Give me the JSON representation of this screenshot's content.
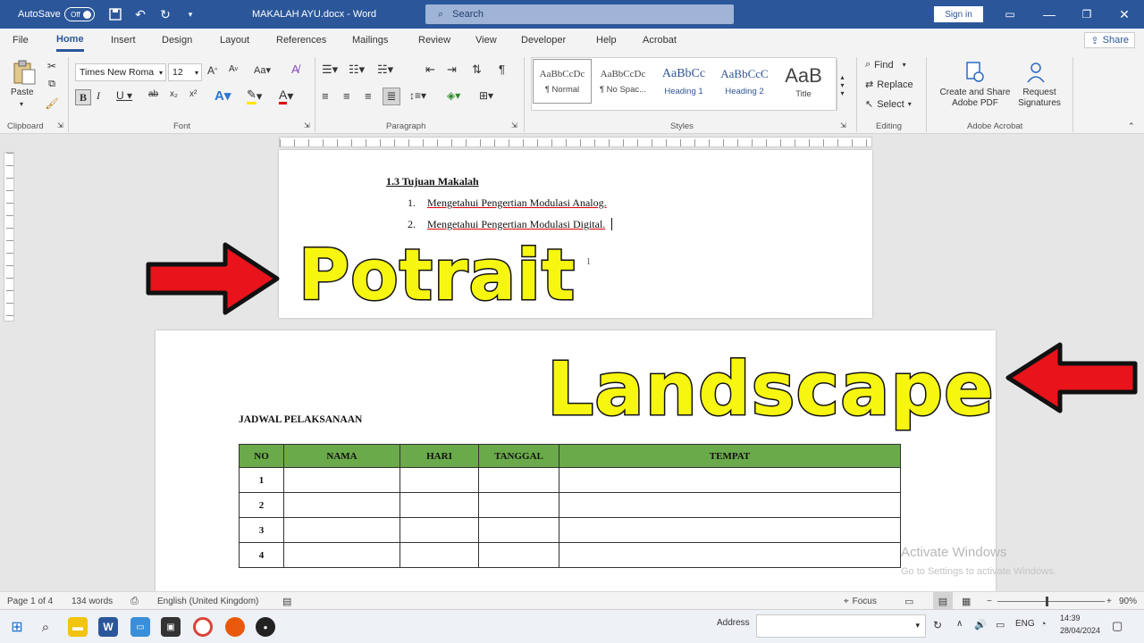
{
  "titlebar": {
    "autosave_label": "AutoSave",
    "autosave_state": "Off",
    "doc_title": "MAKALAH AYU.docx - Word",
    "search_placeholder": "Search",
    "signin_label": "Sign in"
  },
  "menu": {
    "items": [
      "File",
      "Home",
      "Insert",
      "Design",
      "Layout",
      "References",
      "Mailings",
      "Review",
      "View",
      "Developer",
      "Help",
      "Acrobat"
    ],
    "active": "Home",
    "share_label": "Share"
  },
  "ribbon": {
    "font_name": "Times New Roma",
    "font_size": "12",
    "paste_label": "Paste",
    "styles": [
      {
        "sample": "AaBbCcDc",
        "label": "¶ Normal"
      },
      {
        "sample": "AaBbCcDc",
        "label": "¶ No Spac..."
      },
      {
        "sample": "AaBbCc",
        "label": "Heading 1"
      },
      {
        "sample": "AaBbCcC",
        "label": "Heading 2"
      },
      {
        "sample": "AaB",
        "label": "Title"
      }
    ],
    "editing": {
      "find": "Find",
      "replace": "Replace",
      "select": "Select"
    },
    "acrobat": {
      "create_share": "Create and Share Adobe PDF",
      "request_sig": "Request Signatures"
    },
    "groups": {
      "clipboard": "Clipboard",
      "font": "Font",
      "paragraph": "Paragraph",
      "styles": "Styles",
      "editing": "Editing",
      "adobe": "Adobe Acrobat"
    }
  },
  "document": {
    "heading": "1.3 Tujuan Makalah",
    "list": [
      {
        "num": "1.",
        "text": "Mengetahui Pengertian Modulasi Analog."
      },
      {
        "num": "2.",
        "text": "Mengetahui Pengertian Modulasi Digital."
      }
    ],
    "page_number": "1",
    "table_title": "JADWAL PELAKSANAAN",
    "table_headers": [
      "NO",
      "NAMA",
      "HARI",
      "TANGGAL",
      "TEMPAT"
    ],
    "table_rows": [
      "1",
      "2",
      "3",
      "4"
    ]
  },
  "overlay": {
    "portrait_label": "Potrait",
    "landscape_label": "Landscape",
    "arrow_color": "#e8131b",
    "text_color": "#f6f610"
  },
  "watermark": {
    "line1": "Activate Windows",
    "line2": "Go to Settings to activate Windows."
  },
  "status": {
    "page": "Page 1 of 4",
    "words": "134 words",
    "language": "English (United Kingdom)",
    "focus": "Focus",
    "zoom": "90%"
  },
  "taskbar": {
    "address_label": "Address",
    "lang": "ENG",
    "time": "14:39",
    "date": "28/04/2024"
  }
}
